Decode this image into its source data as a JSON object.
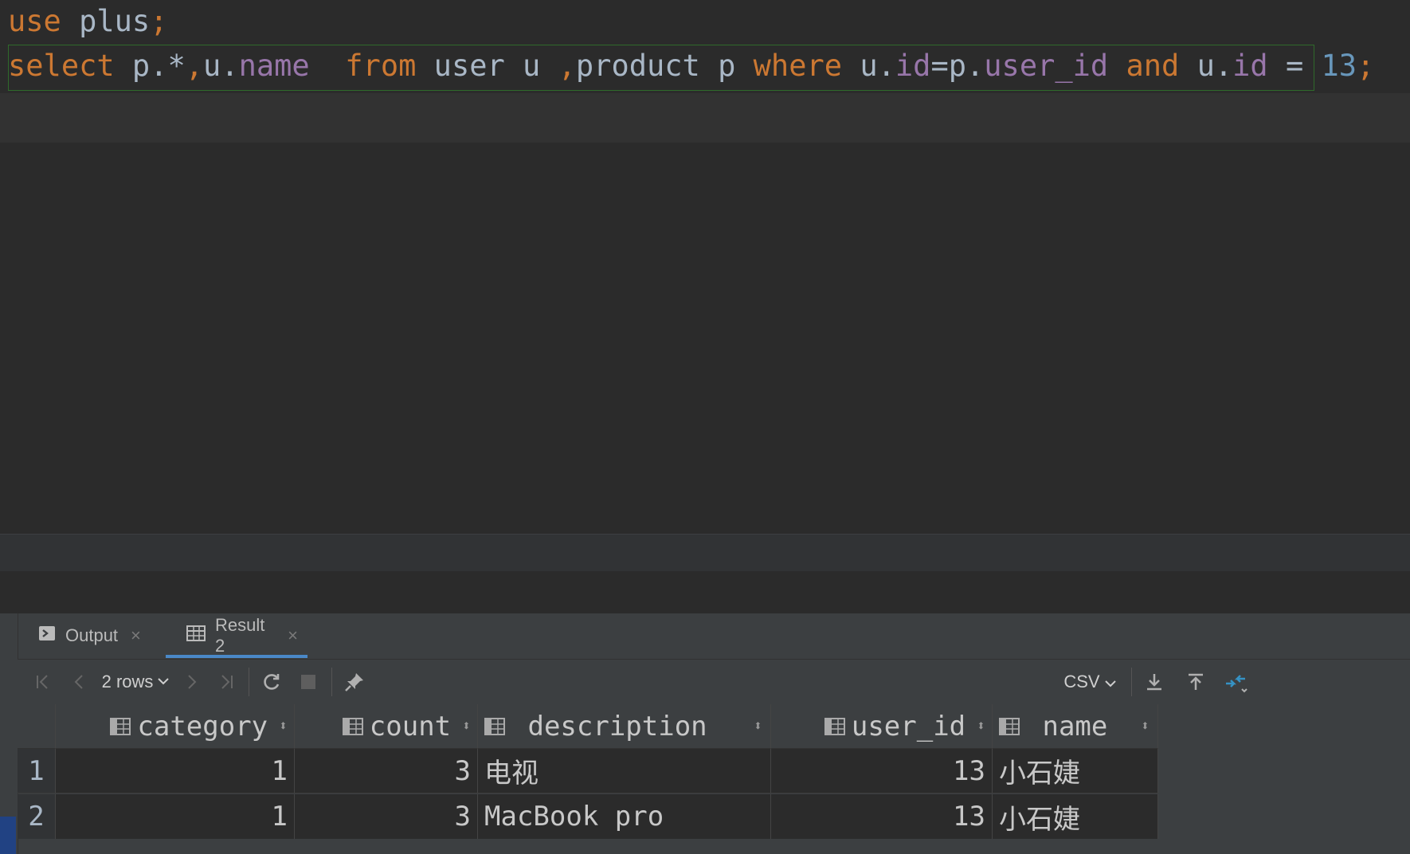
{
  "editor": {
    "line1": [
      {
        "t": "use",
        "c": "kw"
      },
      {
        "t": " plus",
        "c": "plain"
      },
      {
        "t": ";",
        "c": "kw"
      }
    ],
    "line2": [
      {
        "t": "select",
        "c": "kw"
      },
      {
        "t": " p.*",
        "c": "plain"
      },
      {
        "t": ",",
        "c": "kw"
      },
      {
        "t": "u.",
        "c": "plain"
      },
      {
        "t": "name",
        "c": "fld"
      },
      {
        "t": "  ",
        "c": "plain"
      },
      {
        "t": "from",
        "c": "kw"
      },
      {
        "t": " user u ",
        "c": "plain"
      },
      {
        "t": ",",
        "c": "kw"
      },
      {
        "t": "product p ",
        "c": "plain"
      },
      {
        "t": "where",
        "c": "kw"
      },
      {
        "t": " u.",
        "c": "plain"
      },
      {
        "t": "id",
        "c": "fld"
      },
      {
        "t": "=p.",
        "c": "plain"
      },
      {
        "t": "user_id",
        "c": "fld"
      },
      {
        "t": " ",
        "c": "plain"
      },
      {
        "t": "and",
        "c": "kw"
      },
      {
        "t": " u.",
        "c": "plain"
      },
      {
        "t": "id",
        "c": "fld"
      },
      {
        "t": " = ",
        "c": "plain"
      },
      {
        "t": "13",
        "c": "num"
      },
      {
        "t": ";",
        "c": "kw"
      }
    ]
  },
  "tabs": {
    "output_label": "Output",
    "result_label": "Result 2",
    "close_glyph": "×"
  },
  "toolbar": {
    "rows_label": "2 rows",
    "format_label": "CSV",
    "chevron": "⌵"
  },
  "grid": {
    "columns": [
      "category",
      "count",
      "description",
      "user_id",
      "name"
    ],
    "rows": [
      {
        "num": "1",
        "category": "1",
        "count": "3",
        "description": "电视",
        "user_id": "13",
        "name": "小石婕"
      },
      {
        "num": "2",
        "category": "1",
        "count": "3",
        "description": "MacBook pro",
        "user_id": "13",
        "name": "小石婕"
      }
    ]
  },
  "colors": {
    "keyword": "#cc7832",
    "field": "#9876aa",
    "number": "#6897bb",
    "accent": "#4a88c7"
  }
}
